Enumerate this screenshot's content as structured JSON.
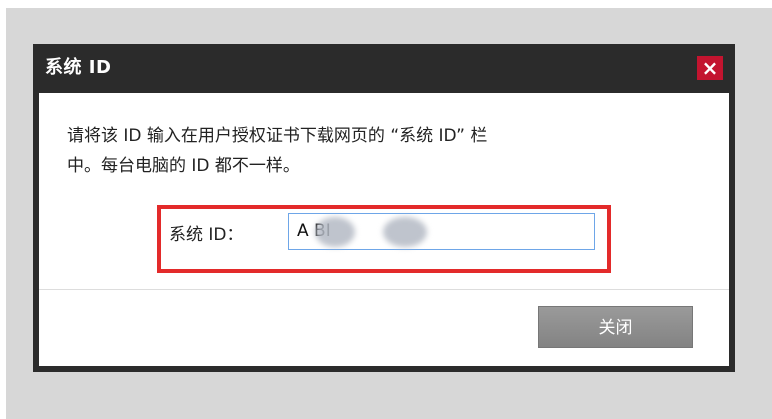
{
  "dialog": {
    "title": "系统 ID",
    "close_icon": "×",
    "message": "请将该 ID 输入在用户授权证书下载网页的 “系统 ID” 栏\n中。每台电脑的 ID 都不一样。",
    "field_label": "系统 ID：",
    "field_value": "A     BI",
    "button_label": "关闭"
  },
  "colors": {
    "titlebar": "#2b2b2b",
    "close_button": "#c3142f",
    "highlight": "#e32a2a",
    "button": "#8e8e8e"
  },
  "icons": {
    "close": "close-icon"
  }
}
